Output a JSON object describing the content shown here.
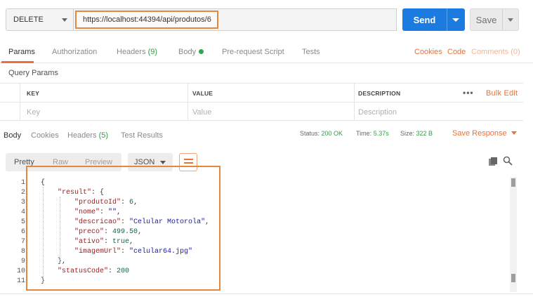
{
  "request": {
    "method": "DELETE",
    "url": "https://localhost:44394/api/produtos/6",
    "send_label": "Send",
    "save_label": "Save"
  },
  "request_tabs": {
    "params": "Params",
    "authorization": "Authorization",
    "headers": "Headers",
    "headers_count": "(9)",
    "body": "Body",
    "prerequest": "Pre-request Script",
    "tests": "Tests",
    "cookies": "Cookies",
    "code": "Code",
    "comments": "Comments (0)"
  },
  "query_params": {
    "title": "Query Params",
    "columns": [
      "KEY",
      "VALUE",
      "DESCRIPTION"
    ],
    "bulk_edit": "Bulk Edit",
    "more": "•••",
    "placeholders": [
      "Key",
      "Value",
      "Description"
    ]
  },
  "response_tabs": {
    "body": "Body",
    "cookies": "Cookies",
    "headers": "Headers",
    "headers_count": "(5)",
    "test_results": "Test Results"
  },
  "response_status": {
    "status_label": "Status:",
    "status_value": "200 OK",
    "time_label": "Time:",
    "time_value": "5.37s",
    "size_label": "Size:",
    "size_value": "322 B",
    "save_response": "Save Response"
  },
  "body_toolbar": {
    "modes": [
      "Pretty",
      "Raw",
      "Preview"
    ],
    "active_mode": "Pretty",
    "format": "JSON"
  },
  "code_lines": [
    {
      "n": "1",
      "text": "{"
    },
    {
      "n": "2",
      "text": "    \"result\": {"
    },
    {
      "n": "3",
      "text": "        \"produtoId\": 6,"
    },
    {
      "n": "4",
      "text": "        \"nome\": \"\","
    },
    {
      "n": "5",
      "text": "        \"descricao\": \"Celular Motorola\","
    },
    {
      "n": "6",
      "text": "        \"preco\": 499.50,"
    },
    {
      "n": "7",
      "text": "        \"ativo\": true,"
    },
    {
      "n": "8",
      "text": "        \"imagemUrl\": \"celular64.jpg\""
    },
    {
      "n": "9",
      "text": "    },"
    },
    {
      "n": "10",
      "text": "    \"statusCode\": 200"
    },
    {
      "n": "11",
      "text": "}"
    }
  ],
  "colors": {
    "accent": "#e8723a",
    "send": "#1b7be0",
    "success": "#2f9e44",
    "highlight": "#e8873a"
  },
  "icons": [
    "chevron-down-icon",
    "wrap-lines-icon",
    "copy-icon",
    "search-icon"
  ]
}
